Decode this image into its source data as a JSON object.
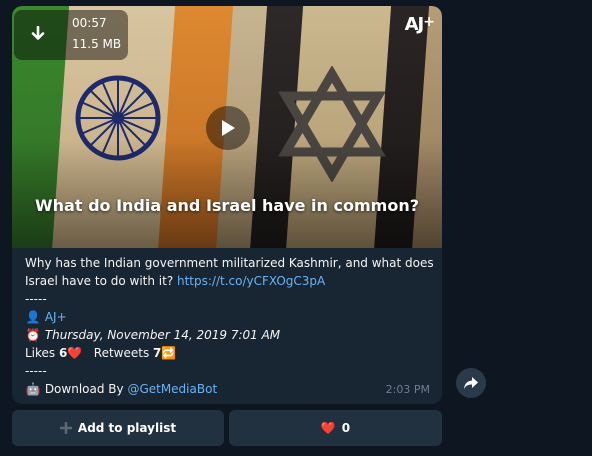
{
  "video": {
    "duration": "00:57",
    "size": "11.5 MB",
    "logo_text": "AJ",
    "logo_plus": "+",
    "title": "What do India and Israel have in common?"
  },
  "caption": {
    "line1": "Why has the Indian government militarized Kashmir, and what does",
    "line2_text": "Israel have to do with it? ",
    "line2_link": "https://t.co/yCFXOgC3pA",
    "sep1": "-----",
    "author_emoji": "👤",
    "author": "AJ+",
    "date_emoji": "⏰",
    "date": "Thursday, November 14, 2019 7:01 AM",
    "likes_label": "Likes ",
    "likes_count": "6",
    "likes_emoji": "❤️",
    "retweets_label": "Retweets ",
    "retweets_count": "7",
    "retweets_emoji": "🔁",
    "sep2": "-----",
    "bot_emoji": "🤖",
    "download_label": " Download By ",
    "bot_link": "@GetMediaBot"
  },
  "message": {
    "time": "2:03 PM"
  },
  "keyboard": {
    "playlist_icon": "plus-icon",
    "playlist_label": "Add to playlist",
    "like_emoji": "❤️",
    "like_count": "0"
  },
  "colors": {
    "background": "#0e1621",
    "bubble": "#182533",
    "link": "#6ab3f3",
    "button": "#223140"
  }
}
